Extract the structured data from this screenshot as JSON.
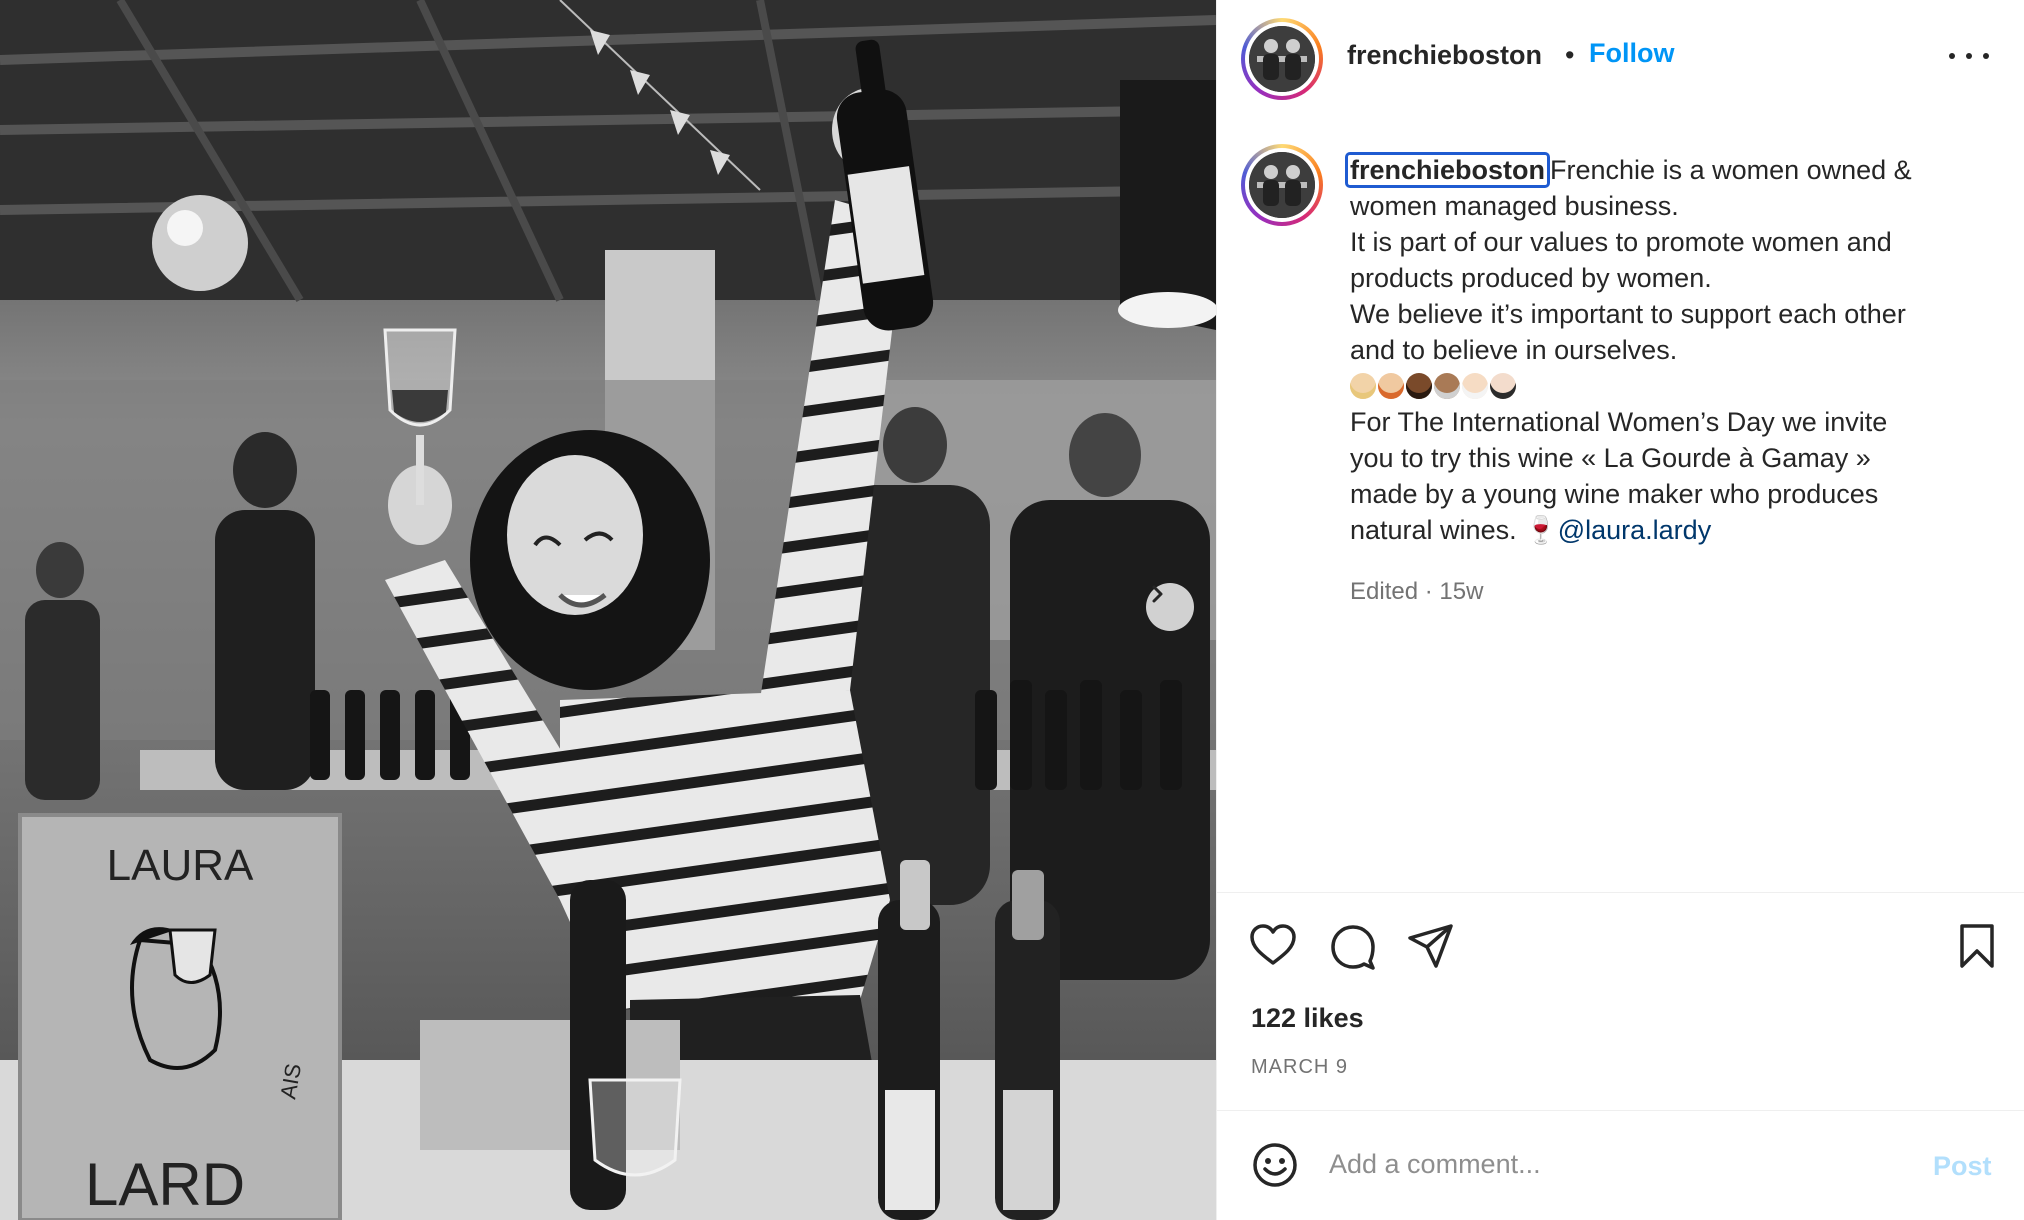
{
  "post": {
    "username": "frenchieboston",
    "separator": "•",
    "follow_label": "Follow",
    "more_icon": "more-horizontal-icon",
    "next_icon": "chevron-right-icon"
  },
  "caption": {
    "username": "frenchieboston",
    "lines": [
      "Frenchie is a women owned &",
      "women managed business.",
      "It is part of our values to promote women and",
      "products produced by women.",
      "We believe it’s important to support each other",
      "and to believe in ourselves."
    ],
    "emojis": [
      "woman-blond-hair",
      "woman-red-hair",
      "woman-dark-skin",
      "older-woman",
      "older-woman-white-hair",
      "woman-dark-hair"
    ],
    "lines2": [
      "For The International Women’s Day we invite",
      "you to try this wine « La Gourde à Gamay »",
      "made by a young wine maker who produces"
    ],
    "last_line_text": "natural wines. ",
    "wine_glyph": "🍷",
    "mention": "@laura.lardy",
    "meta": "Edited · 15w"
  },
  "actions": {
    "like_icon": "heart-icon",
    "comment_icon": "comment-icon",
    "share_icon": "share-icon",
    "save_icon": "bookmark-icon",
    "likes": "122 likes",
    "date": "MARCH 9"
  },
  "comment": {
    "placeholder": "Add a comment...",
    "post_label": "Post",
    "emoji_icon": "smiley-icon"
  },
  "photo": {
    "sign_text_top": "LAURA",
    "sign_text_bottom": "LARD",
    "sign_side_text": "AIS"
  },
  "colors": {
    "follow": "#0095f6",
    "mention": "#00376b",
    "post_disabled": "#b2dffc",
    "muted": "#737373"
  }
}
